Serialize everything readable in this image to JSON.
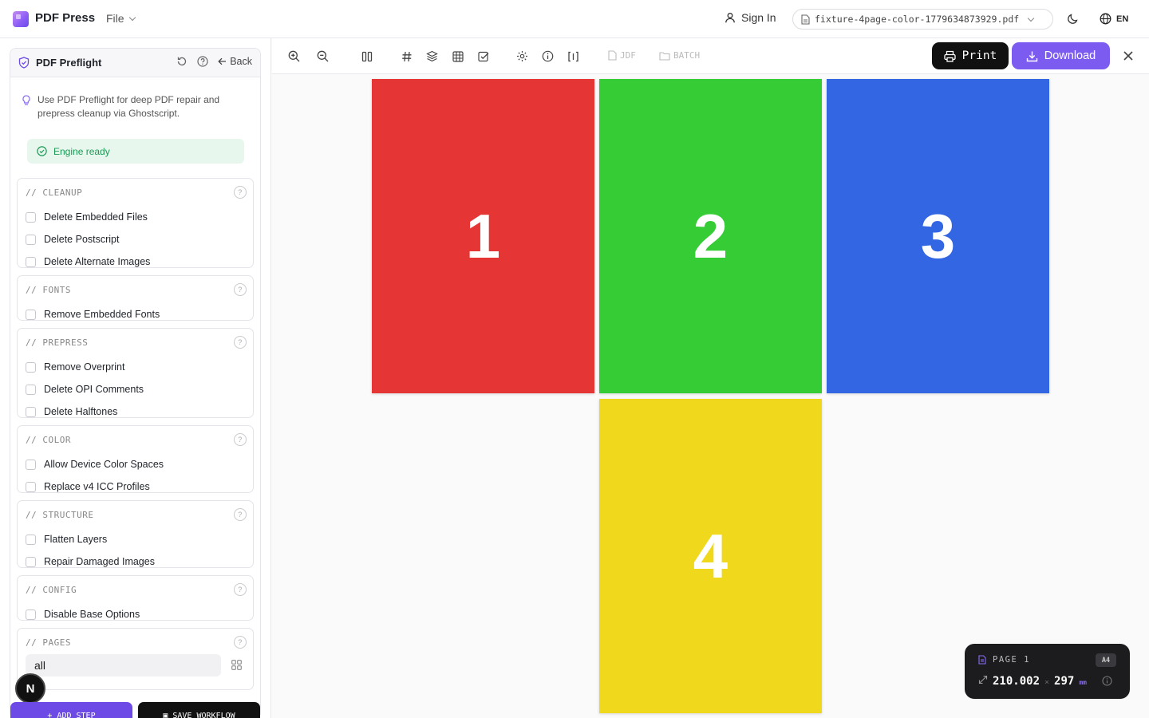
{
  "app": {
    "name": "PDF Press",
    "file_menu": "File",
    "sign_in": "Sign In",
    "file_name": "fixture-4page-color-1779634873929.pdf",
    "lang": "EN"
  },
  "panel": {
    "title": "PDF Preflight",
    "back": "Back",
    "tip": "Use PDF Preflight for deep PDF repair and prepress cleanup via Ghostscript.",
    "engine_status": "Engine ready",
    "groups": [
      {
        "title": "// CLEANUP",
        "options": [
          "Delete Embedded Files",
          "Delete Postscript",
          "Delete Alternate Images"
        ]
      },
      {
        "title": "// FONTS",
        "options": [
          "Remove Embedded Fonts"
        ]
      },
      {
        "title": "// PREPRESS",
        "options": [
          "Remove Overprint",
          "Delete OPI Comments",
          "Delete Halftones"
        ]
      },
      {
        "title": "// COLOR",
        "options": [
          "Allow Device Color Spaces",
          "Replace v4 ICC Profiles"
        ]
      },
      {
        "title": "// STRUCTURE",
        "options": [
          "Flatten Layers",
          "Repair Damaged Images"
        ]
      },
      {
        "title": "// CONFIG",
        "options": [
          "Disable Base Options"
        ]
      },
      {
        "title": "// PAGES",
        "input_value": "all"
      }
    ],
    "add_step": "ADD STEP",
    "save_workflow": "SAVE WORKFLOW",
    "badge": "N"
  },
  "toolbar": {
    "jdf": "JDF",
    "batch": "BATCH",
    "print": "Print",
    "download": "Download"
  },
  "pages": [
    {
      "label": "1",
      "color": "#e53535"
    },
    {
      "label": "2",
      "color": "#35cc35"
    },
    {
      "label": "3",
      "color": "#3366e3"
    },
    {
      "label": "4",
      "color": "#f0d91c"
    }
  ],
  "page_info": {
    "page_label": "PAGE 1",
    "size": "A4",
    "width": "210.002",
    "height": "297",
    "unit": "mm"
  },
  "colors": {
    "accent": "#7c5cf0",
    "success": "#1a9a55"
  }
}
